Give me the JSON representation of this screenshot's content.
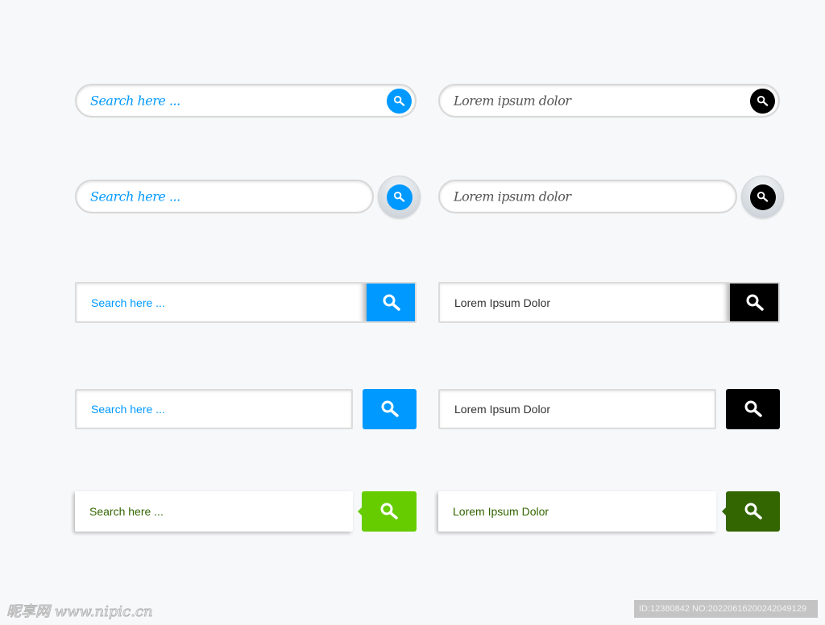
{
  "colors": {
    "blue": "#0099ff",
    "black": "#000000",
    "green": "#66cc00",
    "dark_green": "#336600",
    "gray_text": "#555555"
  },
  "icon": "search-icon",
  "left": {
    "row1": "Search here ...",
    "row2": "Search here ...",
    "row3": "Search here ...",
    "row4": "Search here ...",
    "row5": "Search here ..."
  },
  "right": {
    "row1": "Lorem ipsum dolor",
    "row2": "Lorem ipsum dolor",
    "row3": "Lorem Ipsum Dolor",
    "row4": "Lorem Ipsum Dolor",
    "row5": "Lorem Ipsum Dolor"
  },
  "watermark": {
    "logo": "昵享网 www.nipic.cn",
    "id_text": "ID:12380842 NO:20220616200242049129"
  }
}
